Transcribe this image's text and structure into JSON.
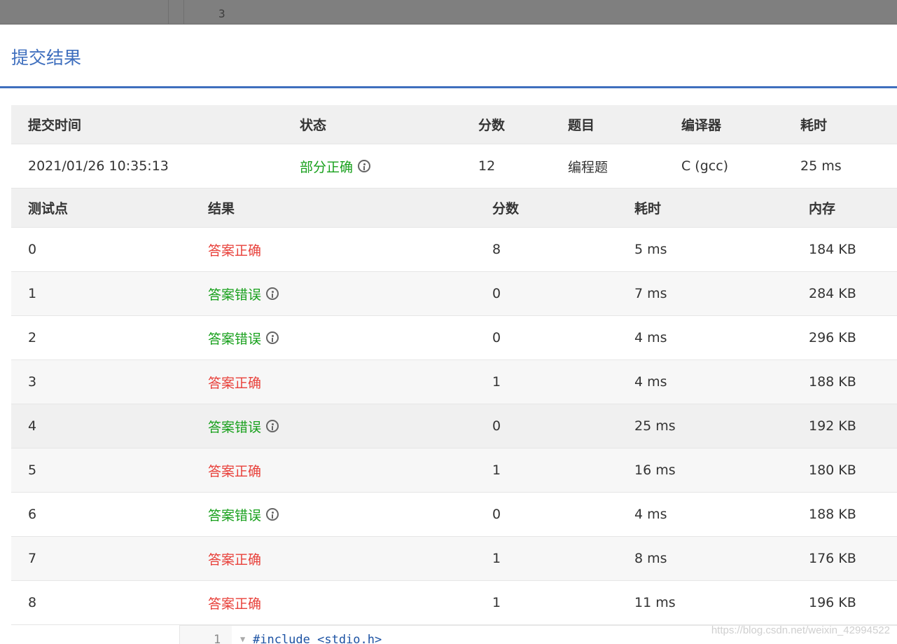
{
  "background_editor": {
    "line_number": "3"
  },
  "modal": {
    "title": "提交结果"
  },
  "submission": {
    "headers": {
      "time": "提交时间",
      "status": "状态",
      "score": "分数",
      "problem": "题目",
      "compiler": "编译器",
      "elapsed": "耗时"
    },
    "row": {
      "time": "2021/01/26 10:35:13",
      "status": "部分正确",
      "score": "12",
      "problem": "编程题",
      "compiler": "C (gcc)",
      "elapsed": "25 ms"
    }
  },
  "tests": {
    "headers": {
      "case": "测试点",
      "result": "结果",
      "score": "分数",
      "elapsed": "耗时",
      "memory": "内存"
    },
    "rows": [
      {
        "case": "0",
        "result": "答案正确",
        "score": "8",
        "elapsed": "5 ms",
        "memory": "184 KB"
      },
      {
        "case": "1",
        "result": "答案错误",
        "score": "0",
        "elapsed": "7 ms",
        "memory": "284 KB"
      },
      {
        "case": "2",
        "result": "答案错误",
        "score": "0",
        "elapsed": "4 ms",
        "memory": "296 KB"
      },
      {
        "case": "3",
        "result": "答案正确",
        "score": "1",
        "elapsed": "4 ms",
        "memory": "188 KB"
      },
      {
        "case": "4",
        "result": "答案错误",
        "score": "0",
        "elapsed": "25 ms",
        "memory": "192 KB"
      },
      {
        "case": "5",
        "result": "答案正确",
        "score": "1",
        "elapsed": "16 ms",
        "memory": "180 KB"
      },
      {
        "case": "6",
        "result": "答案错误",
        "score": "0",
        "elapsed": "4 ms",
        "memory": "188 KB"
      },
      {
        "case": "7",
        "result": "答案正确",
        "score": "1",
        "elapsed": "8 ms",
        "memory": "176 KB"
      },
      {
        "case": "8",
        "result": "答案正确",
        "score": "1",
        "elapsed": "11 ms",
        "memory": "196 KB"
      }
    ]
  },
  "code_editor": {
    "line_number": "1",
    "code_line": "#include <stdio.h>"
  },
  "watermark": "https://blog.csdn.net/weixin_42994522",
  "colors": {
    "accent": "#3f6fbe",
    "accepted": "#e8403a",
    "wrong_or_partial": "#18a01c"
  }
}
